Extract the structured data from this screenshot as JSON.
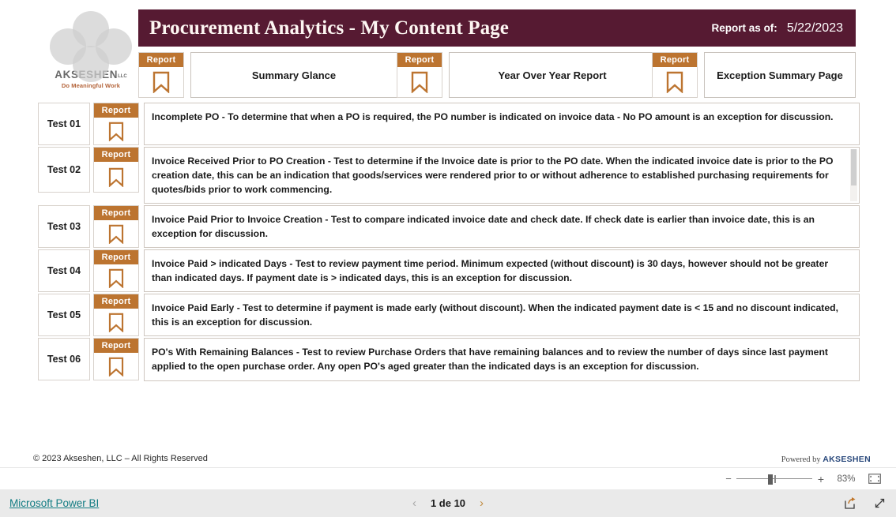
{
  "brand": {
    "logo_name": "AKSESHEN",
    "logo_suffix": "LLC",
    "tagline": "Do Meaningful Work"
  },
  "header": {
    "title": "Procurement Analytics - My Content Page",
    "report_as_of_label": "Report as of:",
    "report_as_of_date": "5/22/2023",
    "bar_color": "#561a32",
    "accent_color": "#bc7430"
  },
  "topnav": {
    "bookmark_caption": "Report",
    "buttons": [
      {
        "label": "Summary Glance"
      },
      {
        "label": "Year Over Year Report"
      },
      {
        "label": "Exception Summary Page"
      }
    ]
  },
  "tests": [
    {
      "label": "Test 01",
      "bookmark_caption": "Report",
      "description": "Incomplete PO - To determine that when a PO is required, the PO number is indicated on invoice data - No PO amount is an exception for discussion.",
      "has_scrollbar": false
    },
    {
      "label": "Test 02",
      "bookmark_caption": "Report",
      "description": "Invoice Received Prior to PO Creation - Test to determine if the Invoice date is prior to the PO date.  When the indicated invoice date is prior to the PO creation date, this can be an indication that goods/services were rendered prior to or without adherence to established purchasing requirements for quotes/bids prior to work commencing.",
      "has_scrollbar": true
    },
    {
      "label": "Test 03",
      "bookmark_caption": "Report",
      "description": "Invoice Paid Prior to Invoice Creation - Test to compare indicated invoice date and check date.  If check date is earlier than invoice date, this is an exception for discussion.",
      "has_scrollbar": false
    },
    {
      "label": "Test 04",
      "bookmark_caption": "Report",
      "description": "Invoice Paid > indicated Days - Test to review payment time period.  Minimum expected (without discount) is 30 days, however should not be greater than indicated days.  If payment date is > indicated days, this is an exception for discussion.",
      "has_scrollbar": false
    },
    {
      "label": "Test 05",
      "bookmark_caption": "Report",
      "description": "Invoice Paid Early - Test to determine if payment is made early (without discount).  When the indicated payment date is < 15 and no discount indicated, this is an exception for discussion.",
      "has_scrollbar": false
    },
    {
      "label": "Test 06",
      "bookmark_caption": "Report",
      "description": "PO's With Remaining Balances - Test to review Purchase Orders that have remaining balances and to review the number of days since last payment applied to the open purchase order.  Any open PO's aged greater than the indicated days is an exception for discussion.",
      "has_scrollbar": false
    }
  ],
  "page_footer": {
    "copyright": "© 2023 Akseshen, LLC – All Rights Reserved",
    "powered_by_prefix": "Powered by ",
    "powered_by_brand": "AKSESHEN"
  },
  "zoombar": {
    "minus_label": "−",
    "plus_label": "+",
    "zoom_level": "83%",
    "fit_icon": "fit-to-page-icon"
  },
  "bottombar": {
    "powerbi_link": "Microsoft Power BI",
    "prev_icon": "chevron-left-icon",
    "next_icon": "chevron-right-icon",
    "page_indicator": "1 de 10",
    "share_icon": "share-icon",
    "fullscreen_icon": "fullscreen-icon"
  }
}
